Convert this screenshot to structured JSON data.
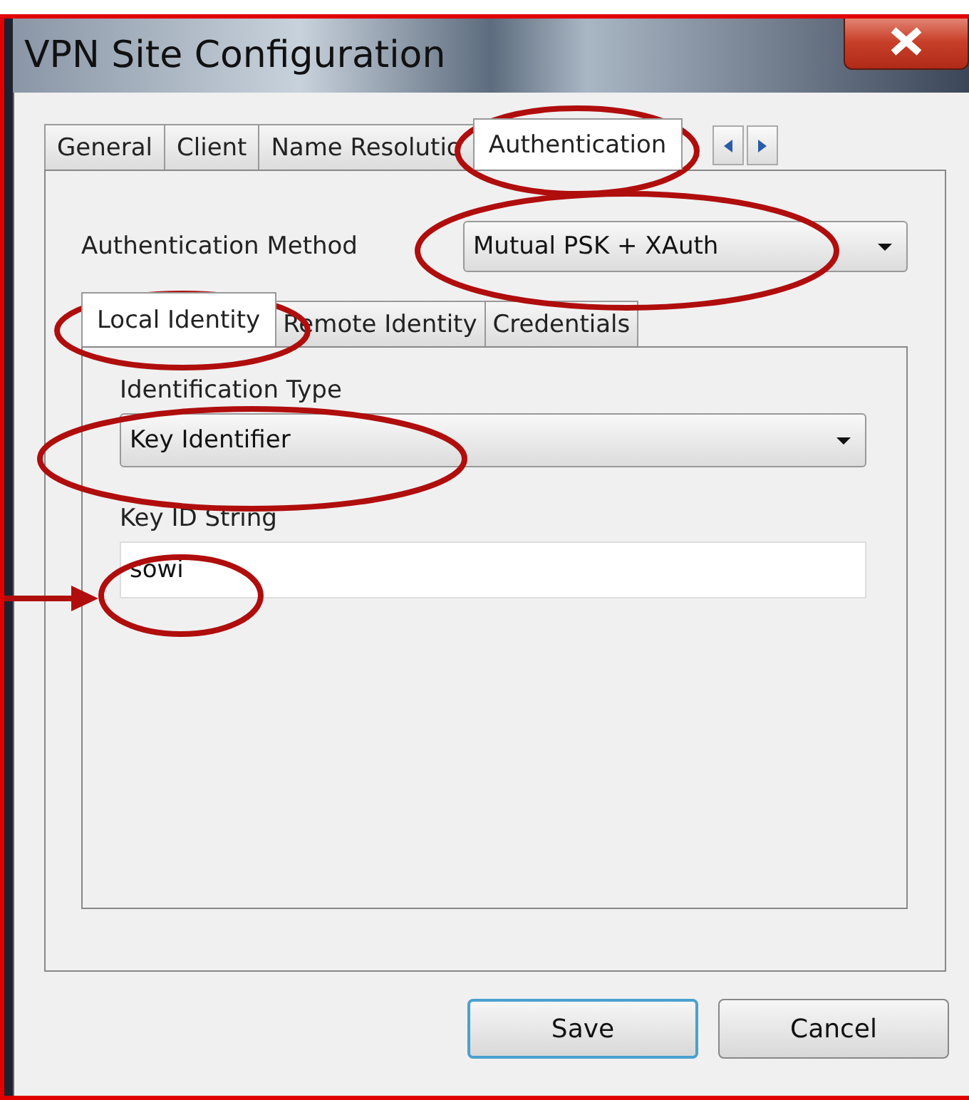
{
  "window": {
    "title": "VPN Site Configuration"
  },
  "tabs": [
    {
      "label": "General",
      "selected": false
    },
    {
      "label": "Client",
      "selected": false
    },
    {
      "label": "Name Resolutio",
      "selected": false
    },
    {
      "label": "Authentication",
      "selected": true
    }
  ],
  "authentication_method": {
    "label": "Authentication Method",
    "value": "Mutual PSK + XAuth"
  },
  "sub_tabs": [
    {
      "label": "Local Identity",
      "selected": true
    },
    {
      "label": "Remote Identity",
      "selected": false
    },
    {
      "label": "Credentials",
      "selected": false
    }
  ],
  "identification_type": {
    "label": "Identification Type",
    "value": "Key Identifier"
  },
  "key_id_string": {
    "label": "Key ID String",
    "value": "sowi"
  },
  "buttons": [
    {
      "label": "Save",
      "default": true
    },
    {
      "label": "Cancel",
      "default": false
    }
  ]
}
